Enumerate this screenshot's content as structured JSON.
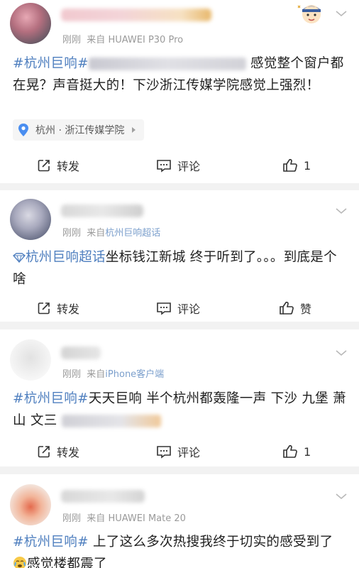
{
  "comments": [
    {
      "time": "刚刚",
      "from_prefix": "来自",
      "source": "HUAWEI P30 Pro",
      "content_tag": "#杭州巨响#",
      "content_text": "感觉整个窗户都在晃？声音挺大的！下沙浙江传媒学院感觉上强烈！",
      "location": "杭州 · 浙江传媒学院",
      "repost_label": "转发",
      "comment_label": "评论",
      "like_label": "1"
    },
    {
      "time": "刚刚",
      "from_prefix": "来自",
      "source": "杭州巨响超话",
      "content_tag": "杭州巨响超话",
      "content_text": "坐标钱江新城 终于听到了。。。到底是个啥",
      "repost_label": "转发",
      "comment_label": "评论",
      "like_label": "赞"
    },
    {
      "time": "刚刚",
      "from_prefix": "来自",
      "source": "iPhone客户端",
      "content_tag": "#杭州巨响#",
      "content_tag2": "天天巨响",
      "content_text": " 半个杭州都轰隆一声 下沙 九堡 萧山 文三",
      "repost_label": "转发",
      "comment_label": "评论",
      "like_label": "1"
    },
    {
      "time": "刚刚",
      "from_prefix": "来自",
      "source": "HUAWEI Mate 20",
      "content_tag": "#杭州巨响#",
      "content_text": " 上了这么多次热搜我终于切实的感受到了",
      "content_text2": "感觉楼都震了"
    }
  ]
}
